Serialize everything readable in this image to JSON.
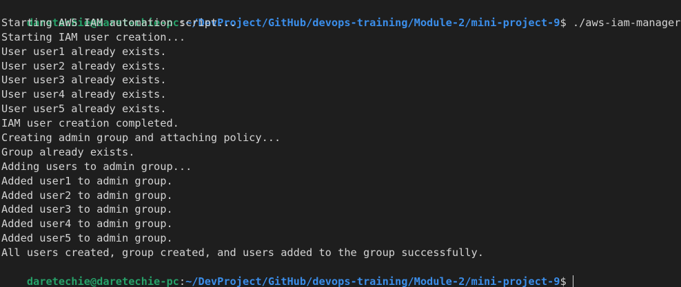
{
  "prompt": {
    "user_host": "daretechie@daretechie-pc",
    "colon": ":",
    "path": "~/DevProject/GitHub/devops-training/Module-2/mini-project-9",
    "dollar": "$ "
  },
  "command": "./aws-iam-manager.sh",
  "output": [
    "Starting AWS IAM automation script...",
    "Starting IAM user creation...",
    "User user1 already exists.",
    "User user2 already exists.",
    "User user3 already exists.",
    "User user4 already exists.",
    "User user5 already exists.",
    "IAM user creation completed.",
    "Creating admin group and attaching policy...",
    "Group already exists.",
    "Adding users to admin group...",
    "Added user1 to admin group.",
    "Added user2 to admin group.",
    "Added user3 to admin group.",
    "Added user4 to admin group.",
    "Added user5 to admin group.",
    "All users created, group created, and users added to the group successfully."
  ],
  "colors": {
    "background": "#1e1e1e",
    "text": "#d4d4d4",
    "user_host": "#26a269",
    "path": "#3b8eea"
  }
}
